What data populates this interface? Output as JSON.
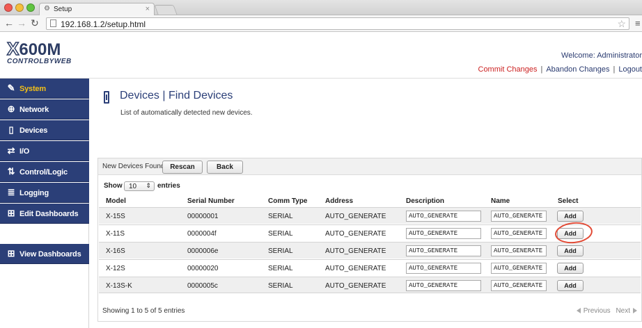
{
  "browser": {
    "tab_title": "Setup",
    "tab_close": "×",
    "url": "192.168.1.2/setup.html"
  },
  "header": {
    "logo_model_x": "X",
    "logo_model_rest": "600M",
    "logo_brand": "CONTROLBYWEB",
    "welcome": "Welcome: Administrator",
    "commit_changes": "Commit Changes",
    "separator": "|",
    "abandon_changes": "Abandon Changes",
    "logout": "Logout"
  },
  "sidebar": {
    "items": [
      {
        "label": "System",
        "icon": "wrench-icon",
        "glyph": "✎",
        "active": true
      },
      {
        "label": "Network",
        "icon": "globe-icon",
        "glyph": "⊕",
        "active": false
      },
      {
        "label": "Devices",
        "icon": "device-icon",
        "glyph": "▯",
        "active": false
      },
      {
        "label": "I/O",
        "icon": "io-arrows-icon",
        "glyph": "⇄",
        "active": false
      },
      {
        "label": "Control/Logic",
        "icon": "logic-icon",
        "glyph": "⇅",
        "active": false
      },
      {
        "label": "Logging",
        "icon": "logging-icon",
        "glyph": "≣",
        "active": false
      },
      {
        "label": "Edit Dashboards",
        "icon": "dashboard-edit-icon",
        "glyph": "⊞",
        "active": false
      },
      {
        "label": "View Dashboards",
        "icon": "dashboard-view-icon",
        "glyph": "⊞",
        "active": false
      }
    ]
  },
  "main": {
    "title": "Devices | Find Devices",
    "subtitle": "List of automatically detected new devices.",
    "panel": {
      "label": "New Devices Found",
      "rescan_label": "Rescan",
      "back_label": "Back",
      "show_label": "Show",
      "entries_value": "10",
      "entries_label": "entries",
      "columns": [
        "Model",
        "Serial Number",
        "Comm Type",
        "Address",
        "Description",
        "Name",
        "Select"
      ],
      "rows": [
        {
          "model": "X-15S",
          "serial": "00000001",
          "comm": "SERIAL",
          "address": "AUTO_GENERATE",
          "description": "AUTO_GENERATE",
          "name": "AUTO_GENERATE",
          "select": "Add"
        },
        {
          "model": "X-11S",
          "serial": "0000004f",
          "comm": "SERIAL",
          "address": "AUTO_GENERATE",
          "description": "AUTO_GENERATE",
          "name": "AUTO_GENERATE",
          "select": "Add"
        },
        {
          "model": "X-16S",
          "serial": "0000006e",
          "comm": "SERIAL",
          "address": "AUTO_GENERATE",
          "description": "AUTO_GENERATE",
          "name": "AUTO_GENERATE",
          "select": "Add"
        },
        {
          "model": "X-12S",
          "serial": "00000020",
          "comm": "SERIAL",
          "address": "AUTO_GENERATE",
          "description": "AUTO_GENERATE",
          "name": "AUTO_GENERATE",
          "select": "Add"
        },
        {
          "model": "X-13S-K",
          "serial": "0000005c",
          "comm": "SERIAL",
          "address": "AUTO_GENERATE",
          "description": "AUTO_GENERATE",
          "name": "AUTO_GENERATE",
          "select": "Add"
        }
      ],
      "footer_info": "Showing 1 to 5 of 5 entries",
      "previous_label": "Previous",
      "next_label": "Next"
    }
  },
  "colors": {
    "sidebar_bg": "#2b3f78",
    "sidebar_active_text": "#f3c017",
    "commit_red": "#cc2222",
    "highlight": "#e24a35"
  }
}
